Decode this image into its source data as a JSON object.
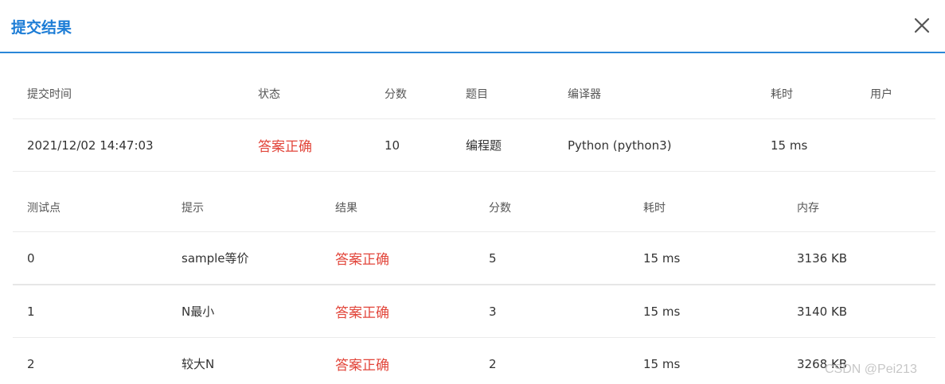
{
  "dialog": {
    "title": "提交结果"
  },
  "summary": {
    "headers": [
      "提交时间",
      "状态",
      "分数",
      "题目",
      "编译器",
      "耗时",
      "用户"
    ],
    "row": {
      "time": "2021/12/02 14:47:03",
      "status": "答案正确",
      "score": "10",
      "problem": "编程题",
      "compiler": "Python (python3)",
      "duration": "15 ms",
      "user": ""
    }
  },
  "testcases": {
    "headers": [
      "测试点",
      "提示",
      "结果",
      "分数",
      "耗时",
      "内存"
    ],
    "rows": [
      {
        "id": "0",
        "hint": "sample等价",
        "result": "答案正确",
        "score": "5",
        "time": "15 ms",
        "memory": "3136 KB"
      },
      {
        "id": "1",
        "hint": "N最小",
        "result": "答案正确",
        "score": "3",
        "time": "15 ms",
        "memory": "3140 KB"
      },
      {
        "id": "2",
        "hint": "较大N",
        "result": "答案正确",
        "score": "2",
        "time": "15 ms",
        "memory": "3268 KB"
      }
    ]
  },
  "watermark": "CSDN @Pei213",
  "colors": {
    "accent": "#1d7dd6",
    "status_ok": "#e2463b"
  },
  "icons": {
    "close": "close-icon"
  }
}
